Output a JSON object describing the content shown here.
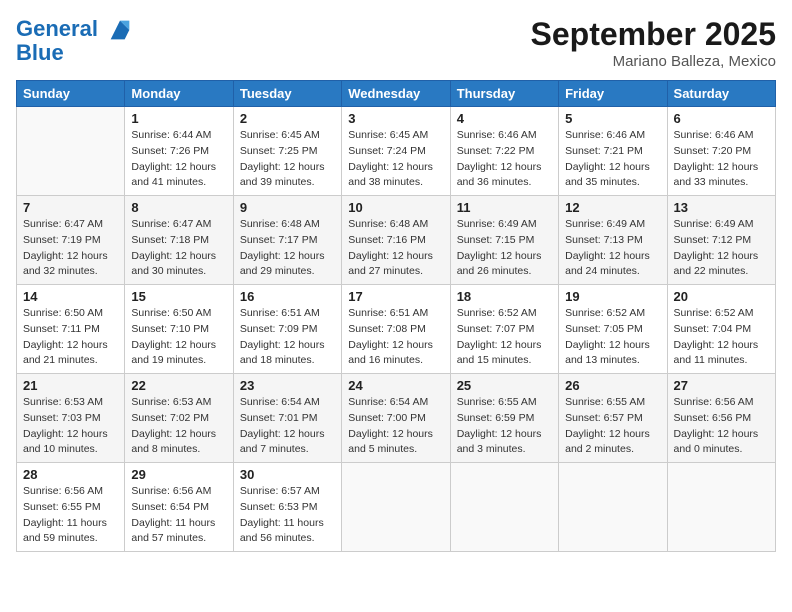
{
  "header": {
    "logo_line1": "General",
    "logo_line2": "Blue",
    "month": "September 2025",
    "location": "Mariano Balleza, Mexico"
  },
  "days_of_week": [
    "Sunday",
    "Monday",
    "Tuesday",
    "Wednesday",
    "Thursday",
    "Friday",
    "Saturday"
  ],
  "weeks": [
    [
      {
        "day": "",
        "info": ""
      },
      {
        "day": "1",
        "info": "Sunrise: 6:44 AM\nSunset: 7:26 PM\nDaylight: 12 hours\nand 41 minutes."
      },
      {
        "day": "2",
        "info": "Sunrise: 6:45 AM\nSunset: 7:25 PM\nDaylight: 12 hours\nand 39 minutes."
      },
      {
        "day": "3",
        "info": "Sunrise: 6:45 AM\nSunset: 7:24 PM\nDaylight: 12 hours\nand 38 minutes."
      },
      {
        "day": "4",
        "info": "Sunrise: 6:46 AM\nSunset: 7:22 PM\nDaylight: 12 hours\nand 36 minutes."
      },
      {
        "day": "5",
        "info": "Sunrise: 6:46 AM\nSunset: 7:21 PM\nDaylight: 12 hours\nand 35 minutes."
      },
      {
        "day": "6",
        "info": "Sunrise: 6:46 AM\nSunset: 7:20 PM\nDaylight: 12 hours\nand 33 minutes."
      }
    ],
    [
      {
        "day": "7",
        "info": "Sunrise: 6:47 AM\nSunset: 7:19 PM\nDaylight: 12 hours\nand 32 minutes."
      },
      {
        "day": "8",
        "info": "Sunrise: 6:47 AM\nSunset: 7:18 PM\nDaylight: 12 hours\nand 30 minutes."
      },
      {
        "day": "9",
        "info": "Sunrise: 6:48 AM\nSunset: 7:17 PM\nDaylight: 12 hours\nand 29 minutes."
      },
      {
        "day": "10",
        "info": "Sunrise: 6:48 AM\nSunset: 7:16 PM\nDaylight: 12 hours\nand 27 minutes."
      },
      {
        "day": "11",
        "info": "Sunrise: 6:49 AM\nSunset: 7:15 PM\nDaylight: 12 hours\nand 26 minutes."
      },
      {
        "day": "12",
        "info": "Sunrise: 6:49 AM\nSunset: 7:13 PM\nDaylight: 12 hours\nand 24 minutes."
      },
      {
        "day": "13",
        "info": "Sunrise: 6:49 AM\nSunset: 7:12 PM\nDaylight: 12 hours\nand 22 minutes."
      }
    ],
    [
      {
        "day": "14",
        "info": "Sunrise: 6:50 AM\nSunset: 7:11 PM\nDaylight: 12 hours\nand 21 minutes."
      },
      {
        "day": "15",
        "info": "Sunrise: 6:50 AM\nSunset: 7:10 PM\nDaylight: 12 hours\nand 19 minutes."
      },
      {
        "day": "16",
        "info": "Sunrise: 6:51 AM\nSunset: 7:09 PM\nDaylight: 12 hours\nand 18 minutes."
      },
      {
        "day": "17",
        "info": "Sunrise: 6:51 AM\nSunset: 7:08 PM\nDaylight: 12 hours\nand 16 minutes."
      },
      {
        "day": "18",
        "info": "Sunrise: 6:52 AM\nSunset: 7:07 PM\nDaylight: 12 hours\nand 15 minutes."
      },
      {
        "day": "19",
        "info": "Sunrise: 6:52 AM\nSunset: 7:05 PM\nDaylight: 12 hours\nand 13 minutes."
      },
      {
        "day": "20",
        "info": "Sunrise: 6:52 AM\nSunset: 7:04 PM\nDaylight: 12 hours\nand 11 minutes."
      }
    ],
    [
      {
        "day": "21",
        "info": "Sunrise: 6:53 AM\nSunset: 7:03 PM\nDaylight: 12 hours\nand 10 minutes."
      },
      {
        "day": "22",
        "info": "Sunrise: 6:53 AM\nSunset: 7:02 PM\nDaylight: 12 hours\nand 8 minutes."
      },
      {
        "day": "23",
        "info": "Sunrise: 6:54 AM\nSunset: 7:01 PM\nDaylight: 12 hours\nand 7 minutes."
      },
      {
        "day": "24",
        "info": "Sunrise: 6:54 AM\nSunset: 7:00 PM\nDaylight: 12 hours\nand 5 minutes."
      },
      {
        "day": "25",
        "info": "Sunrise: 6:55 AM\nSunset: 6:59 PM\nDaylight: 12 hours\nand 3 minutes."
      },
      {
        "day": "26",
        "info": "Sunrise: 6:55 AM\nSunset: 6:57 PM\nDaylight: 12 hours\nand 2 minutes."
      },
      {
        "day": "27",
        "info": "Sunrise: 6:56 AM\nSunset: 6:56 PM\nDaylight: 12 hours\nand 0 minutes."
      }
    ],
    [
      {
        "day": "28",
        "info": "Sunrise: 6:56 AM\nSunset: 6:55 PM\nDaylight: 11 hours\nand 59 minutes."
      },
      {
        "day": "29",
        "info": "Sunrise: 6:56 AM\nSunset: 6:54 PM\nDaylight: 11 hours\nand 57 minutes."
      },
      {
        "day": "30",
        "info": "Sunrise: 6:57 AM\nSunset: 6:53 PM\nDaylight: 11 hours\nand 56 minutes."
      },
      {
        "day": "",
        "info": ""
      },
      {
        "day": "",
        "info": ""
      },
      {
        "day": "",
        "info": ""
      },
      {
        "day": "",
        "info": ""
      }
    ]
  ]
}
